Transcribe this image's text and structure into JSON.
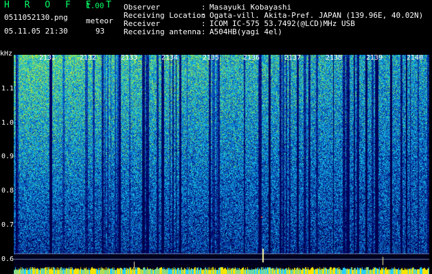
{
  "header": {
    "title": "H R O F F T",
    "version": "1.00",
    "filename": "0511052130.png",
    "datetime": "05.11.05 21:30",
    "meteor_label": "meteor",
    "meteor_count": "93"
  },
  "info": [
    {
      "label": "Observer",
      "colon": ":",
      "value": "Masayuki Kobayashi"
    },
    {
      "label": "Receiving Location",
      "colon": ":",
      "value": "Ogata-vill. Akita-Pref. JAPAN (139.96E, 40.02N)"
    },
    {
      "label": "Receiver",
      "colon": ":",
      "value": "ICOM IC-575 53.7492(@LCD)MHz USB"
    },
    {
      "label": "Receiving antenna",
      "colon": ":",
      "value": "A504HB(yagi 4el)"
    }
  ],
  "axis": {
    "y_unit": "kHz",
    "y_ticks": [
      "1.1",
      "1.0",
      "0.9",
      "0.8",
      "0.7",
      "0.6"
    ],
    "x_ticks": [
      "2131",
      "2132",
      "2133",
      "2134",
      "2135",
      "2136",
      "2137",
      "2138",
      "2139",
      "2140"
    ]
  },
  "colors": {
    "background": "#000000",
    "title_green": "#00ff66",
    "text": "#ffffff",
    "spectrum_low": "#0a1e7a",
    "spectrum_mid": "#1d7fd0",
    "spectrum_high": "#7be36c",
    "baseline_yellow": "#f7e600",
    "baseline_cyan": "#27d0ff"
  },
  "spectrogram": {
    "y_range_khz": [
      0.575,
      1.2
    ],
    "x_range_minutes": [
      2130,
      2140
    ]
  }
}
